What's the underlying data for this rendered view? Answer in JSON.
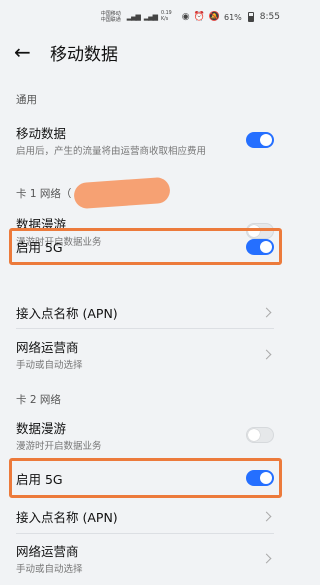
{
  "status_bar": {
    "carrier1": "中国移动",
    "carrier2": "中国联通",
    "speed_value": "0.19",
    "speed_unit": "K/s",
    "battery_percent": "61%",
    "time": "8:55",
    "icons": [
      "hd-icon",
      "signal-icon",
      "signal-icon",
      "eye-icon",
      "alarm-icon",
      "mute-icon",
      "battery-icon"
    ]
  },
  "header": {
    "back_icon": "arrow-left-icon",
    "title": "移动数据"
  },
  "general": {
    "section_label": "通用",
    "mobile_data": {
      "label": "移动数据",
      "desc": "启用后，产生的流量将由运营商收取相应费用",
      "enabled": true
    }
  },
  "sim1": {
    "section_label": "卡 1 网络（",
    "roaming": {
      "label": "数据漫游",
      "desc": "漫游时开启数据业务",
      "enabled": false
    },
    "enable_5g": {
      "label": "启用 5G",
      "enabled": true
    },
    "apn": {
      "label": "接入点名称 (APN)"
    },
    "operator": {
      "label": "网络运营商",
      "desc": "手动或自动选择"
    }
  },
  "sim2": {
    "section_label": "卡 2 网络",
    "roaming": {
      "label": "数据漫游",
      "desc": "漫游时开启数据业务",
      "enabled": false
    },
    "enable_5g": {
      "label": "启用 5G",
      "enabled": true
    },
    "apn": {
      "label": "接入点名称 (APN)"
    },
    "operator": {
      "label": "网络运营商",
      "desc": "手动或自动选择"
    }
  },
  "colors": {
    "accent": "#256fff",
    "highlight": "#ec7a3b",
    "redaction": "#f6a173"
  }
}
